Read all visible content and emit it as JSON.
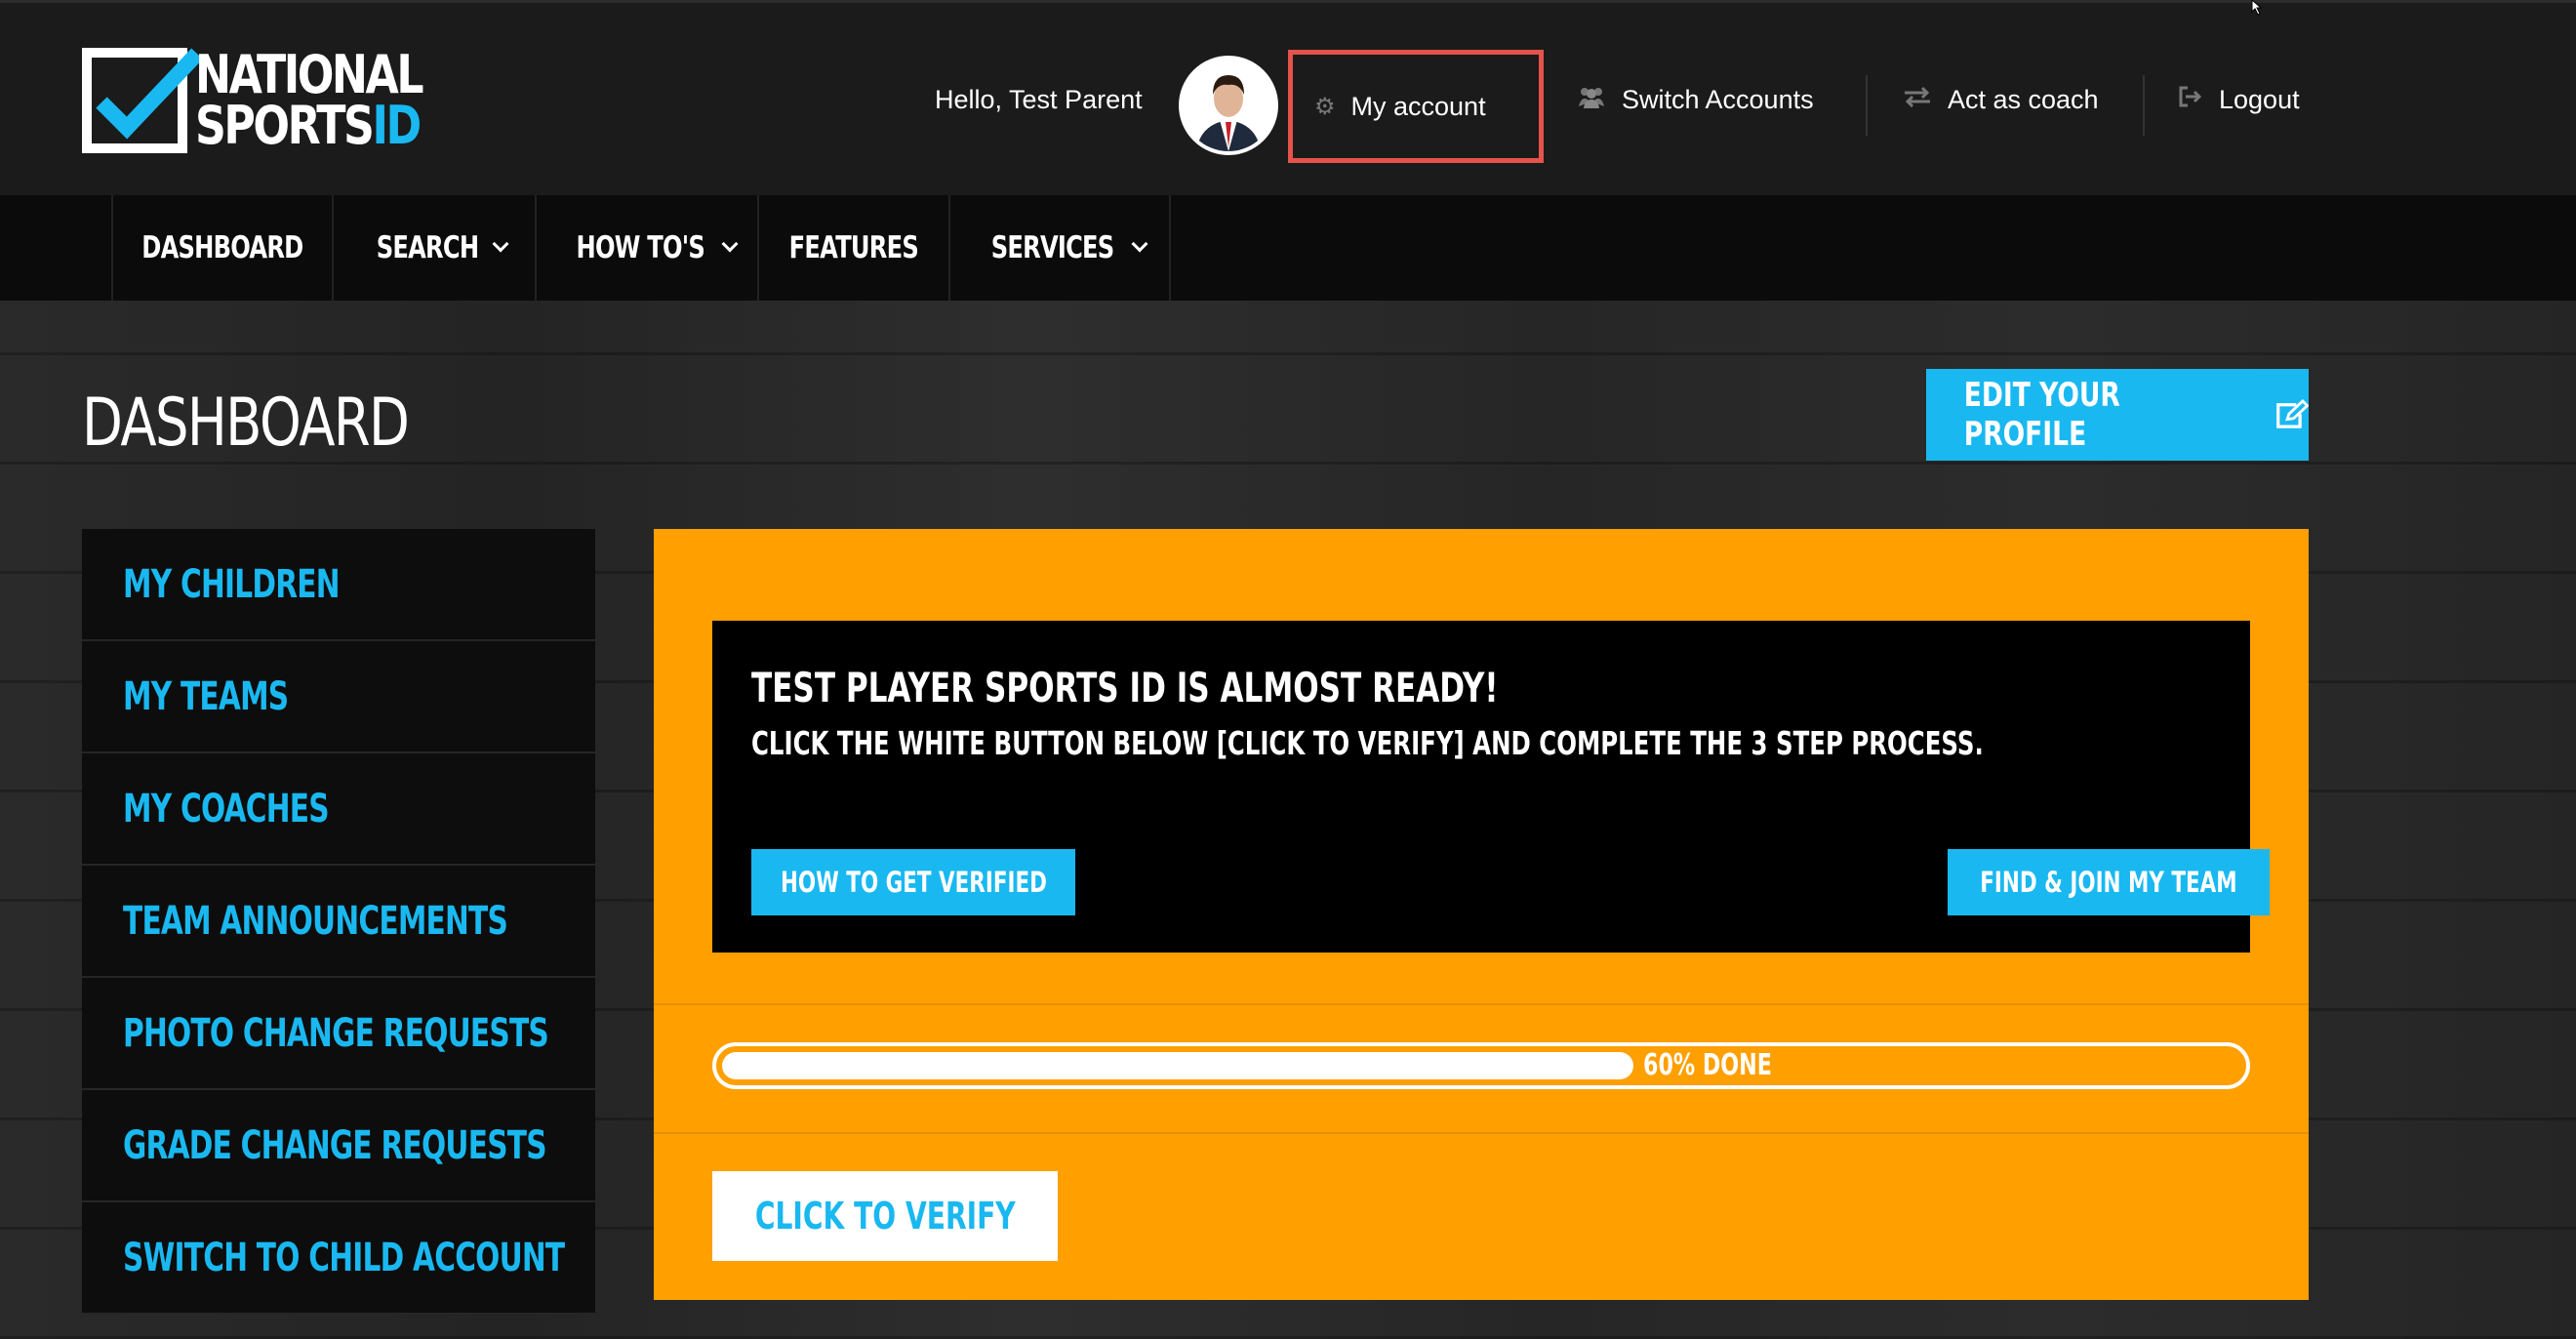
{
  "brand": {
    "line1": "NATIONAL",
    "line2": "SPORTS",
    "line2_accent": "ID",
    "accent_color": "#1ab8f0"
  },
  "header": {
    "greeting": "Hello, Test Parent",
    "my_account": "My account",
    "switch_accounts": "Switch Accounts",
    "act_as_coach": "Act as coach",
    "logout": "Logout",
    "highlight_color": "#e5534b"
  },
  "nav": {
    "items": [
      {
        "label": "DASHBOARD",
        "has_dropdown": false
      },
      {
        "label": "SEARCH",
        "has_dropdown": true
      },
      {
        "label": "HOW TO'S",
        "has_dropdown": true
      },
      {
        "label": "FEATURES",
        "has_dropdown": false
      },
      {
        "label": "SERVICES",
        "has_dropdown": true
      }
    ]
  },
  "page": {
    "title": "DASHBOARD",
    "edit_profile": "EDIT YOUR PROFILE"
  },
  "sidebar": {
    "items": [
      {
        "label": "MY CHILDREN"
      },
      {
        "label": "MY TEAMS"
      },
      {
        "label": "MY COACHES"
      },
      {
        "label": "TEAM ANNOUNCEMENTS"
      },
      {
        "label": "PHOTO CHANGE REQUESTS"
      },
      {
        "label": "GRADE CHANGE REQUESTS"
      },
      {
        "label": "SWITCH TO CHILD ACCOUNT"
      }
    ]
  },
  "notice": {
    "title": "TEST PLAYER SPORTS ID IS ALMOST READY!",
    "subtitle": "CLICK THE WHITE BUTTON BELOW [CLICK TO VERIFY] AND COMPLETE THE 3 STEP PROCESS.",
    "how_to_verified": "HOW TO GET VERIFIED",
    "find_join_team": "FIND & JOIN MY TEAM"
  },
  "progress": {
    "percent": 60,
    "label": "60% DONE"
  },
  "verify": {
    "label": "CLICK TO VERIFY"
  },
  "colors": {
    "panel": "#ff9f00",
    "blue": "#1ab8f0"
  }
}
